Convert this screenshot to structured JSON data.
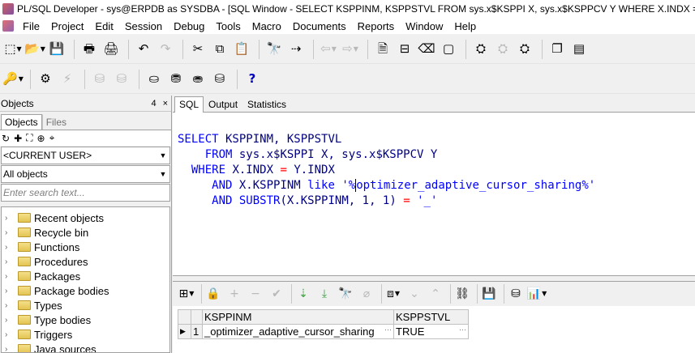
{
  "window": {
    "title": "PL/SQL Developer - sys@ERPDB as SYSDBA - [SQL Window - SELECT KSPPINM, KSPPSTVL FROM sys.x$KSPPI X, sys.x$KSPPCV Y WHERE X.INDX = Y.INDX"
  },
  "menu": {
    "items": [
      "File",
      "Project",
      "Edit",
      "Session",
      "Debug",
      "Tools",
      "Macro",
      "Documents",
      "Reports",
      "Window",
      "Help"
    ]
  },
  "left_panel": {
    "title": "Objects",
    "pin": "4",
    "close": "×",
    "tabs": [
      "Objects",
      "Files"
    ],
    "user_select": "<CURRENT USER>",
    "objects_select": "All objects",
    "search_placeholder": "Enter search text...",
    "tree_items": [
      "Recent objects",
      "Recycle bin",
      "Functions",
      "Procedures",
      "Packages",
      "Package bodies",
      "Types",
      "Type bodies",
      "Triggers",
      "Java sources"
    ]
  },
  "editor": {
    "tabs": [
      "SQL",
      "Output",
      "Statistics"
    ],
    "line1": {
      "kw": "SELECT",
      "rest": " KSPPINM, KSPPSTVL"
    },
    "line2": {
      "kw": "FROM",
      "rest": " sys.x$KSPPI X, sys.x$KSPPCV Y"
    },
    "line3": {
      "kw": "WHERE",
      "a": " X.INDX ",
      "op": "=",
      "b": " Y.INDX"
    },
    "line4": {
      "kw": "AND",
      "a": " X.KSPPINM ",
      "kw2": "like",
      "str1": " '%",
      "str2": "optimizer_adaptive_cursor_sharing%'"
    },
    "line5": {
      "kw": "AND",
      "fn": " SUBSTR",
      "p1": "(X.KSPPINM, ",
      "n1": "1",
      "c": ", ",
      "n2": "1",
      "p2": ") ",
      "op": "=",
      "str": " '_'"
    }
  },
  "results": {
    "columns": [
      "KSPPINM",
      "KSPPSTVL"
    ],
    "rows": [
      {
        "marker": "▶",
        "num": "1",
        "ksppinm": "_optimizer_adaptive_cursor_sharing",
        "ksppstvl": "TRUE"
      }
    ],
    "dots": "···"
  }
}
